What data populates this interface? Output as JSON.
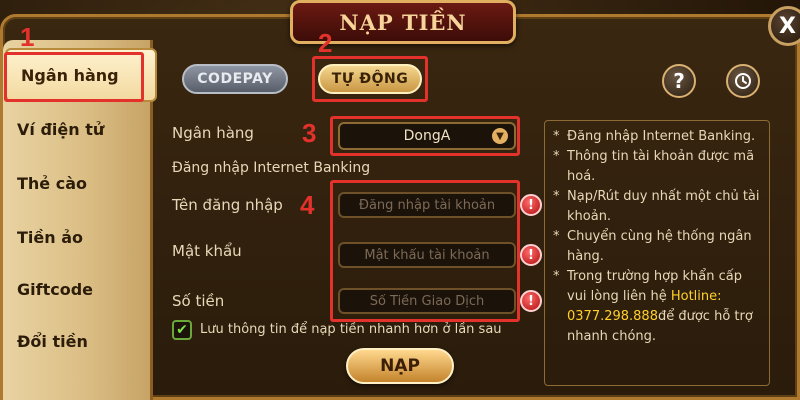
{
  "title": "NẠP TIỀN",
  "close_label": "X",
  "annotations": [
    "1",
    "2",
    "3",
    "4"
  ],
  "sidebar": {
    "items": [
      {
        "label": "Ngân hàng",
        "active": true
      },
      {
        "label": "Ví điện tử",
        "active": false
      },
      {
        "label": "Thẻ cào",
        "active": false
      },
      {
        "label": "Tiền ảo",
        "active": false
      },
      {
        "label": "Giftcode",
        "active": false
      },
      {
        "label": "Đổi tiền",
        "active": false
      }
    ]
  },
  "tabs": [
    {
      "label": "CODEPAY",
      "active": false
    },
    {
      "label": "TỰ ĐỘNG",
      "active": true
    }
  ],
  "icons": {
    "help": "?",
    "history": "history-icon"
  },
  "form": {
    "bank_label": "Ngân hàng",
    "bank_value": "DongA",
    "section_label": "Đăng nhập Internet Banking",
    "username_label": "Tên đăng nhập",
    "username_placeholder": "Đăng nhập tài khoản",
    "password_label": "Mật khẩu",
    "password_placeholder": "Mật khẩu tài khoản",
    "amount_label": "Số tiền",
    "amount_placeholder": "Số Tiền Giao Dịch",
    "remember_label": "Lưu thông tin để nạp tiền nhanh hơn ở lần sau",
    "remember_checked": true,
    "submit_label": "NẠP"
  },
  "notes": {
    "n1": "Đăng nhập Internet Banking.",
    "n2": "Thông tin tài khoản được mã hoá.",
    "n3": "Nạp/Rút duy nhất một chủ tài khoản.",
    "n4": "Chuyển cùng hệ thống ngân hàng.",
    "n5_prefix": "Trong trường hợp khẩn cấp vui lòng liên hệ ",
    "n5_hotline_label": "Hotline:",
    "n5_phone": "0377.298.888",
    "n5_suffix": "để được hỗ trợ nhanh chóng."
  },
  "colors": {
    "annotation": "#e3312b",
    "highlight": "#ffd02a",
    "frame": "#b07a2e"
  }
}
